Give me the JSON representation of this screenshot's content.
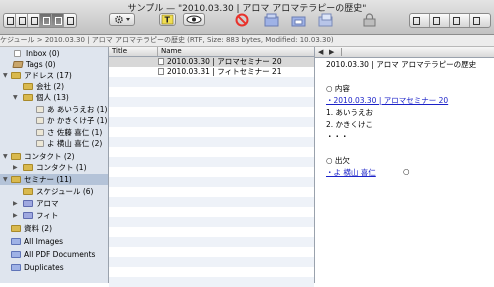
{
  "window": {
    "title": "サンプル — \"2010.03.30 | アロマ アロマテラピーの歴史\""
  },
  "pathbar": {
    "text": "ケジュール > 2010.03.30 | アロマ アロマテラピーの歴史 (RTF, Size: 883 bytes, Modified: 10.03.30)"
  },
  "sidebar": {
    "items": [
      {
        "label": "Inbox (0)",
        "icon": "inbox-icon"
      },
      {
        "label": "Tags (0)",
        "icon": "tag-icon"
      },
      {
        "label": "アドレス (17)",
        "icon": "folder-icon"
      },
      {
        "label": "会社 (2)",
        "icon": "folder-icon"
      },
      {
        "label": "個人 (13)",
        "icon": "folder-icon"
      },
      {
        "label": "あ あいうえお (1)",
        "icon": "contact-icon"
      },
      {
        "label": "か かきくけ子 (1)",
        "icon": "contact-icon"
      },
      {
        "label": "さ 佐藤 喜仁 (1)",
        "icon": "contact-icon"
      },
      {
        "label": "よ 横山 喜仁 (2)",
        "icon": "contact-icon"
      },
      {
        "label": "コンタクト (2)",
        "icon": "folder-icon"
      },
      {
        "label": "コンタクト (1)",
        "icon": "folder-icon"
      },
      {
        "label": "セミナー (11)",
        "icon": "folder-icon"
      },
      {
        "label": "スケジュール (6)",
        "icon": "folder-icon"
      },
      {
        "label": "アロマ",
        "icon": "folder-icon"
      },
      {
        "label": "フィト",
        "icon": "folder-icon"
      },
      {
        "label": "資料 (2)",
        "icon": "folder-icon"
      },
      {
        "label": "All Images",
        "icon": "smart-group-icon"
      },
      {
        "label": "All PDF Documents",
        "icon": "smart-group-icon"
      },
      {
        "label": "Duplicates",
        "icon": "smart-group-icon"
      }
    ]
  },
  "list": {
    "columns": {
      "title": "Title",
      "name": "Name"
    },
    "rows": [
      {
        "name": "2010.03.30 | アロマセミナー 20"
      },
      {
        "name": "2010.03.31 | フィトセミナー 21"
      }
    ]
  },
  "editor": {
    "heading": "2010.03.30 | アロマ アロマテラピーの歴史",
    "section1": "○ 内容",
    "link1": "・2010.03.30 | アロマセミナー 20",
    "item1": "1. あいうえお",
    "item2": "2. かきくけこ",
    "dots": "・・・",
    "section2": "○ 出欠",
    "link2": "・よ 横山 喜仁",
    "circle": "○"
  },
  "colors": {
    "sidebar_bg": "#dfe5ee",
    "selection": "#b4c3d8",
    "link": "#1b22c8",
    "delete": "#e8322c"
  }
}
